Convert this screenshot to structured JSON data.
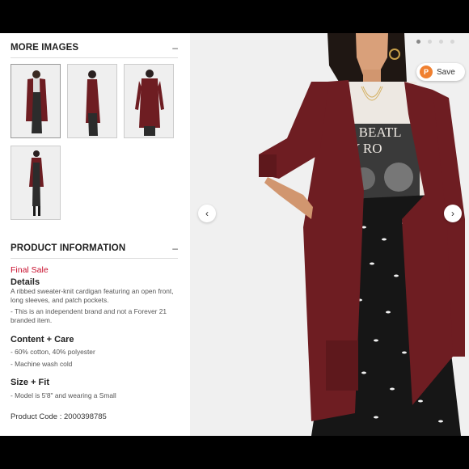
{
  "more_images": {
    "title": "MORE IMAGES",
    "toggle": "–",
    "thumbnails": [
      {
        "alt": "front view"
      },
      {
        "alt": "side view"
      },
      {
        "alt": "back view"
      },
      {
        "alt": "full length"
      }
    ]
  },
  "product_info": {
    "title": "PRODUCT INFORMATION",
    "toggle": "–",
    "final_sale": "Final Sale",
    "details_heading": "Details",
    "details_text": "A ribbed sweater-knit cardigan featuring an open front, long sleeves, and patch pockets.",
    "details_note": "- This is an independent brand and not a Forever 21 branded item.",
    "content_heading": "Content + Care",
    "content_lines": [
      "- 60% cotton, 40% polyester",
      "- Machine wash cold"
    ],
    "size_heading": "Size + Fit",
    "size_line": "- Model is 5'8\" and wearing a Small",
    "product_code": "Product Code : 2000398785"
  },
  "hero": {
    "save_label": "Save",
    "save_icon": "pin-plus-icon",
    "prev_icon": "chevron-left-icon",
    "next_icon": "chevron-right-icon",
    "arrow_prev": "‹",
    "arrow_next": "›",
    "shirt_text_line1": "E BEATL",
    "shirt_text_line2": "Y RO",
    "dots_count": 4
  },
  "colors": {
    "cardigan": "#6e1d22",
    "final_sale": "#c8102e",
    "save_icon_bg": "#f08030"
  }
}
